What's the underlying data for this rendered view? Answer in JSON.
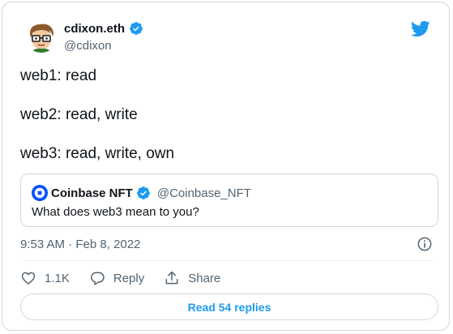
{
  "author": {
    "display_name": "cdixon.eth",
    "handle": "@cdixon",
    "verified": true
  },
  "tweet_lines": [
    "web1: read",
    "web2: read, write",
    "web3: read, write, own"
  ],
  "quoted": {
    "display_name": "Coinbase NFT",
    "handle": "@Coinbase_NFT",
    "verified": true,
    "text": "What does web3 mean to you?"
  },
  "timestamp": "9:53 AM · Feb 8, 2022",
  "actions": {
    "like_count": "1.1K",
    "reply_label": "Reply",
    "share_label": "Share"
  },
  "read_replies_label": "Read 54 replies",
  "icons": {
    "brand": "twitter-bird-icon",
    "verified": "verified-badge-icon",
    "like": "heart-icon",
    "reply": "reply-icon",
    "share": "share-icon",
    "info": "info-icon",
    "quote_logo": "coinbase-logo-icon"
  },
  "colors": {
    "twitter_blue": "#1d9bf0",
    "coinbase_blue": "#0052ff",
    "text_primary": "#0f1419",
    "text_secondary": "#536471",
    "border": "#cfd9de"
  }
}
